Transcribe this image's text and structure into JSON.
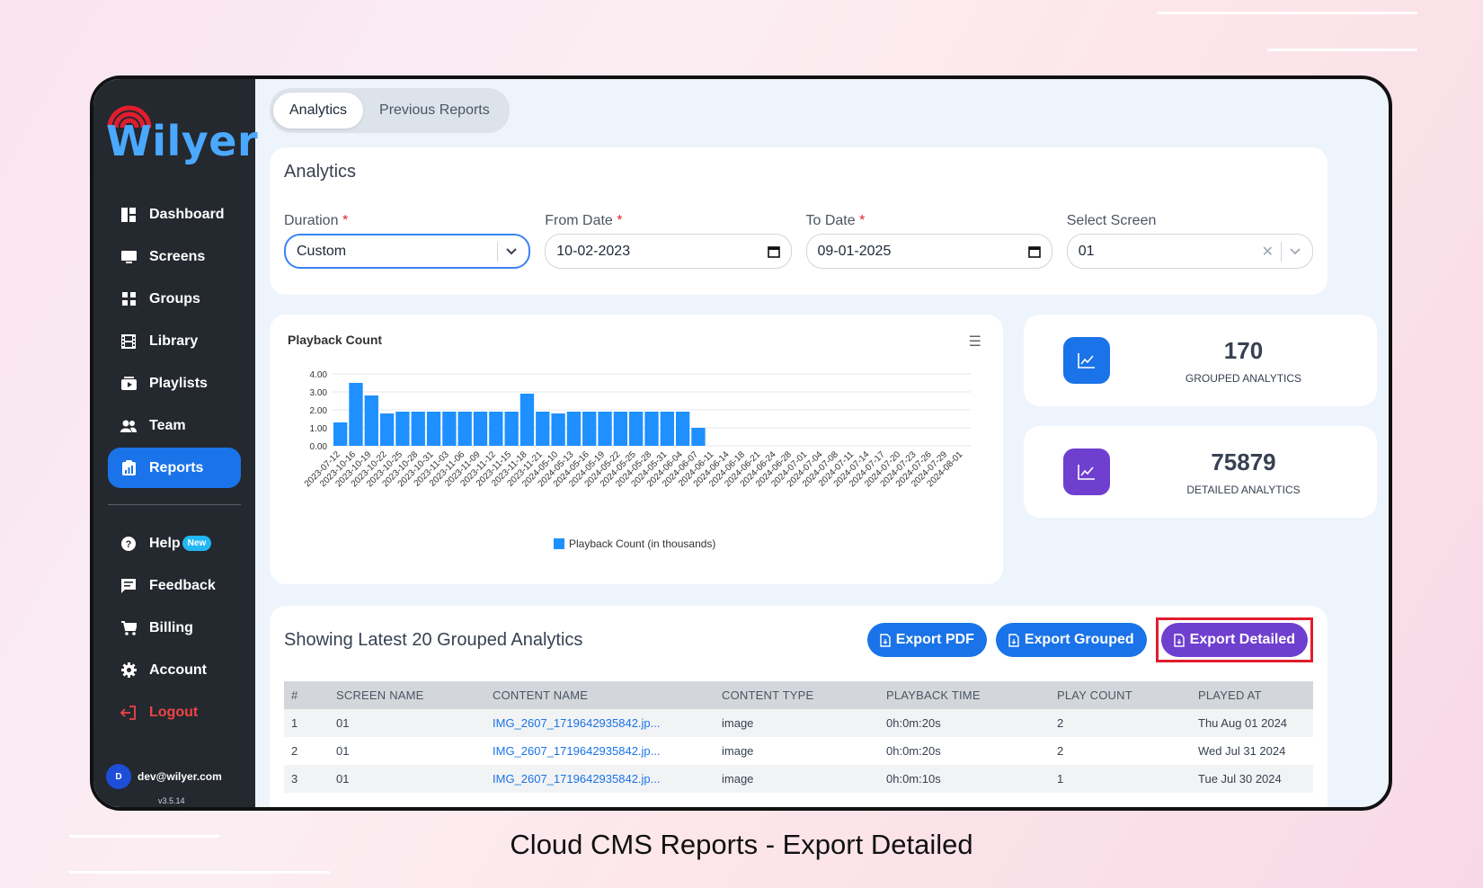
{
  "app": {
    "brand": "Wilyer",
    "user_initial": "D",
    "user_email": "dev@wilyer.com",
    "version": "v3.5.14",
    "accent": "#1a73e8",
    "purple": "#6f3fcf"
  },
  "sidebar": {
    "items": [
      {
        "label": "Dashboard",
        "icon": "dashboard-icon"
      },
      {
        "label": "Screens",
        "icon": "monitor-icon"
      },
      {
        "label": "Groups",
        "icon": "grid-icon"
      },
      {
        "label": "Library",
        "icon": "film-icon"
      },
      {
        "label": "Playlists",
        "icon": "playlist-icon"
      },
      {
        "label": "Team",
        "icon": "team-icon"
      },
      {
        "label": "Reports",
        "icon": "report-icon",
        "active": true
      }
    ],
    "bottom_items": [
      {
        "label": "Help",
        "badge": "New",
        "icon": "help-icon"
      },
      {
        "label": "Feedback",
        "icon": "feedback-icon"
      },
      {
        "label": "Billing",
        "icon": "cart-icon"
      },
      {
        "label": "Account",
        "icon": "gear-icon"
      },
      {
        "label": "Logout",
        "icon": "logout-icon"
      }
    ]
  },
  "tabs": [
    "Analytics",
    "Previous Reports"
  ],
  "filters": {
    "title": "Analytics",
    "duration": {
      "label": "Duration",
      "value": "Custom"
    },
    "from_date": {
      "label": "From Date",
      "value": "10-02-2023"
    },
    "to_date": {
      "label": "To Date",
      "value": "09-01-2025"
    },
    "screen": {
      "label": "Select Screen",
      "value": "01"
    }
  },
  "chart_data": {
    "type": "bar",
    "title": "Playback Count",
    "legend": "Playback Count (in thousands)",
    "ylim": [
      0,
      4
    ],
    "yticks": [
      "0.00",
      "1.00",
      "2.00",
      "3.00",
      "4.00"
    ],
    "categories": [
      "2023-07-12",
      "2023-10-16",
      "2023-10-19",
      "2023-10-22",
      "2023-10-25",
      "2023-10-28",
      "2023-10-31",
      "2023-11-03",
      "2023-11-06",
      "2023-11-09",
      "2023-11-12",
      "2023-11-15",
      "2023-11-18",
      "2023-11-21",
      "2024-05-10",
      "2024-05-13",
      "2024-05-16",
      "2024-05-19",
      "2024-05-22",
      "2024-05-25",
      "2024-05-28",
      "2024-05-31",
      "2024-06-04",
      "2024-06-07",
      "2024-06-11",
      "2024-06-14",
      "2024-06-18",
      "2024-06-21",
      "2024-06-24",
      "2024-06-28",
      "2024-07-01",
      "2024-07-04",
      "2024-07-08",
      "2024-07-11",
      "2024-07-14",
      "2024-07-17",
      "2024-07-20",
      "2024-07-23",
      "2024-07-26",
      "2024-07-29",
      "2024-08-01"
    ],
    "values": [
      1.3,
      3.5,
      2.8,
      1.8,
      1.9,
      1.9,
      1.9,
      1.9,
      1.9,
      1.9,
      1.9,
      1.9,
      2.9,
      1.9,
      1.8,
      1.9,
      1.9,
      1.9,
      1.9,
      1.9,
      1.9,
      1.9,
      1.9,
      1.0,
      0,
      0,
      0,
      0,
      0,
      0,
      0,
      0,
      0,
      0,
      0,
      0,
      0,
      0,
      0,
      0,
      0
    ],
    "bar_color": "#1e90ff"
  },
  "stats": [
    {
      "value": "170",
      "label": "GROUPED ANALYTICS",
      "color": "#1a73e8"
    },
    {
      "value": "75879",
      "label": "DETAILED ANALYTICS",
      "color": "#6f3fcf"
    }
  ],
  "table": {
    "title": "Showing Latest 20 Grouped Analytics",
    "export_pdf": "Export PDF",
    "export_grouped": "Export Grouped",
    "export_detailed": "Export Detailed",
    "columns": [
      "#",
      "SCREEN NAME",
      "CONTENT NAME",
      "CONTENT TYPE",
      "PLAYBACK TIME",
      "PLAY COUNT",
      "PLAYED AT"
    ],
    "rows": [
      [
        "1",
        "01",
        "IMG_2607_1719642935842.jp...",
        "image",
        "0h:0m:20s",
        "2",
        "Thu Aug 01 2024"
      ],
      [
        "2",
        "01",
        "IMG_2607_1719642935842.jp...",
        "image",
        "0h:0m:20s",
        "2",
        "Wed Jul 31 2024"
      ],
      [
        "3",
        "01",
        "IMG_2607_1719642935842.jp...",
        "image",
        "0h:0m:10s",
        "1",
        "Tue Jul 30 2024"
      ]
    ]
  },
  "caption": "Cloud CMS Reports - Export Detailed"
}
